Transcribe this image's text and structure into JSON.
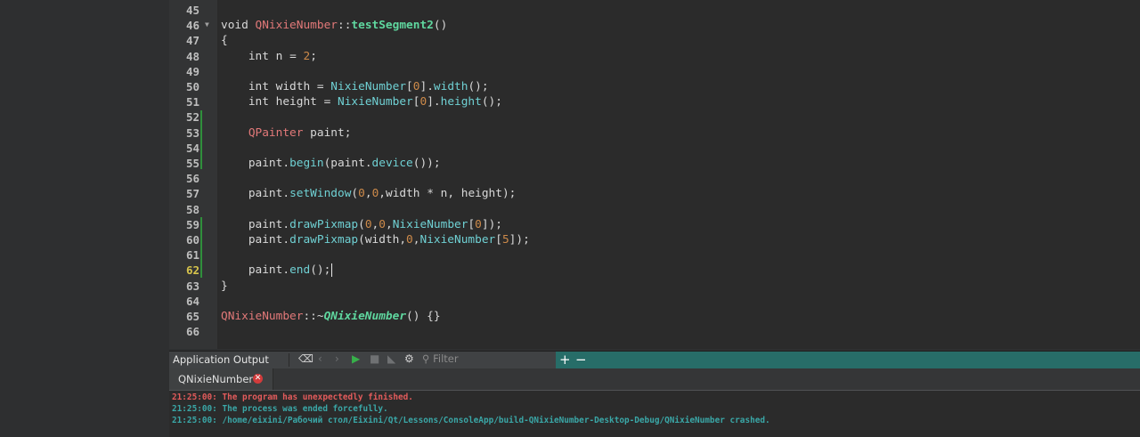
{
  "editor": {
    "line_numbers": [
      "45",
      "46",
      "47",
      "48",
      "49",
      "50",
      "51",
      "52",
      "53",
      "54",
      "55",
      "56",
      "57",
      "58",
      "59",
      "60",
      "61",
      "62",
      "63",
      "64",
      "65",
      "66"
    ],
    "current_line": "62",
    "code_lines": [
      [],
      [
        {
          "t": "void ",
          "c": "kw"
        },
        {
          "t": "QNixieNumber",
          "c": "ty"
        },
        {
          "t": "::",
          "c": "pl"
        },
        {
          "t": "testSegment2",
          "c": "fnb"
        },
        {
          "t": "()",
          "c": "pl"
        }
      ],
      [
        {
          "t": "{",
          "c": "pl"
        }
      ],
      [
        {
          "t": "    int ",
          "c": "kw"
        },
        {
          "t": "n",
          "c": "var"
        },
        {
          "t": " = ",
          "c": "pl"
        },
        {
          "t": "2",
          "c": "num"
        },
        {
          "t": ";",
          "c": "pl"
        }
      ],
      [],
      [
        {
          "t": "    int ",
          "c": "kw"
        },
        {
          "t": "width",
          "c": "var"
        },
        {
          "t": " = ",
          "c": "pl"
        },
        {
          "t": "NixieNumber",
          "c": "fn"
        },
        {
          "t": "[",
          "c": "pl"
        },
        {
          "t": "0",
          "c": "num"
        },
        {
          "t": "].",
          "c": "pl"
        },
        {
          "t": "width",
          "c": "fn"
        },
        {
          "t": "();",
          "c": "pl"
        }
      ],
      [
        {
          "t": "    int ",
          "c": "kw"
        },
        {
          "t": "height",
          "c": "var"
        },
        {
          "t": " = ",
          "c": "pl"
        },
        {
          "t": "NixieNumber",
          "c": "fn"
        },
        {
          "t": "[",
          "c": "pl"
        },
        {
          "t": "0",
          "c": "num"
        },
        {
          "t": "].",
          "c": "pl"
        },
        {
          "t": "height",
          "c": "fn"
        },
        {
          "t": "();",
          "c": "pl"
        }
      ],
      [],
      [
        {
          "t": "    QPainter ",
          "c": "ty"
        },
        {
          "t": "paint",
          "c": "var"
        },
        {
          "t": ";",
          "c": "pl"
        }
      ],
      [],
      [
        {
          "t": "    paint",
          "c": "var"
        },
        {
          "t": ".",
          "c": "pl"
        },
        {
          "t": "begin",
          "c": "fn"
        },
        {
          "t": "(paint.",
          "c": "pl"
        },
        {
          "t": "device",
          "c": "fn"
        },
        {
          "t": "());",
          "c": "pl"
        }
      ],
      [],
      [
        {
          "t": "    paint",
          "c": "var"
        },
        {
          "t": ".",
          "c": "pl"
        },
        {
          "t": "setWindow",
          "c": "fn"
        },
        {
          "t": "(",
          "c": "pl"
        },
        {
          "t": "0",
          "c": "num"
        },
        {
          "t": ",",
          "c": "pl"
        },
        {
          "t": "0",
          "c": "num"
        },
        {
          "t": ",width * n, height);",
          "c": "pl"
        }
      ],
      [],
      [
        {
          "t": "    paint",
          "c": "var"
        },
        {
          "t": ".",
          "c": "pl"
        },
        {
          "t": "drawPixmap",
          "c": "fn"
        },
        {
          "t": "(",
          "c": "pl"
        },
        {
          "t": "0",
          "c": "num"
        },
        {
          "t": ",",
          "c": "pl"
        },
        {
          "t": "0",
          "c": "num"
        },
        {
          "t": ",",
          "c": "pl"
        },
        {
          "t": "NixieNumber",
          "c": "fn"
        },
        {
          "t": "[",
          "c": "pl"
        },
        {
          "t": "0",
          "c": "num"
        },
        {
          "t": "]);",
          "c": "pl"
        }
      ],
      [
        {
          "t": "    paint",
          "c": "var"
        },
        {
          "t": ".",
          "c": "pl"
        },
        {
          "t": "drawPixmap",
          "c": "fn"
        },
        {
          "t": "(width,",
          "c": "pl"
        },
        {
          "t": "0",
          "c": "num"
        },
        {
          "t": ",",
          "c": "pl"
        },
        {
          "t": "NixieNumber",
          "c": "fn"
        },
        {
          "t": "[",
          "c": "pl"
        },
        {
          "t": "5",
          "c": "num"
        },
        {
          "t": "]);",
          "c": "pl"
        }
      ],
      [],
      [
        {
          "t": "    paint",
          "c": "var"
        },
        {
          "t": ".",
          "c": "pl"
        },
        {
          "t": "end",
          "c": "fn"
        },
        {
          "t": "();",
          "c": "pl"
        },
        {
          "t": "",
          "c": "cursor"
        }
      ],
      [
        {
          "t": "}",
          "c": "pl"
        }
      ],
      [],
      [
        {
          "t": "QNixieNumber",
          "c": "ty"
        },
        {
          "t": "::~",
          "c": "pl"
        },
        {
          "t": "QNixieNumber",
          "c": "fni"
        },
        {
          "t": "() {}",
          "c": "pl"
        }
      ],
      []
    ]
  },
  "output_panel": {
    "title": "Application Output",
    "filter_placeholder": "Filter",
    "plus": "+",
    "minus": "−",
    "tab_label": "QNixieNumber",
    "lines": [
      {
        "text": "21:25:00: The program has unexpectedly finished.",
        "color": "red"
      },
      {
        "text": "21:25:00: The process was ended forcefully.",
        "color": "teal"
      },
      {
        "text": "21:25:00: /home/eixini/Рабочий стол/Eixini/Qt/Lessons/ConsoleApp/build-QNixieNumber-Desktop-Debug/QNixieNumber crashed.",
        "color": "teal"
      }
    ]
  },
  "colors": {
    "accent_teal": "#276d68",
    "error_red": "#e35b5b",
    "info_teal": "#3aa7a7"
  }
}
